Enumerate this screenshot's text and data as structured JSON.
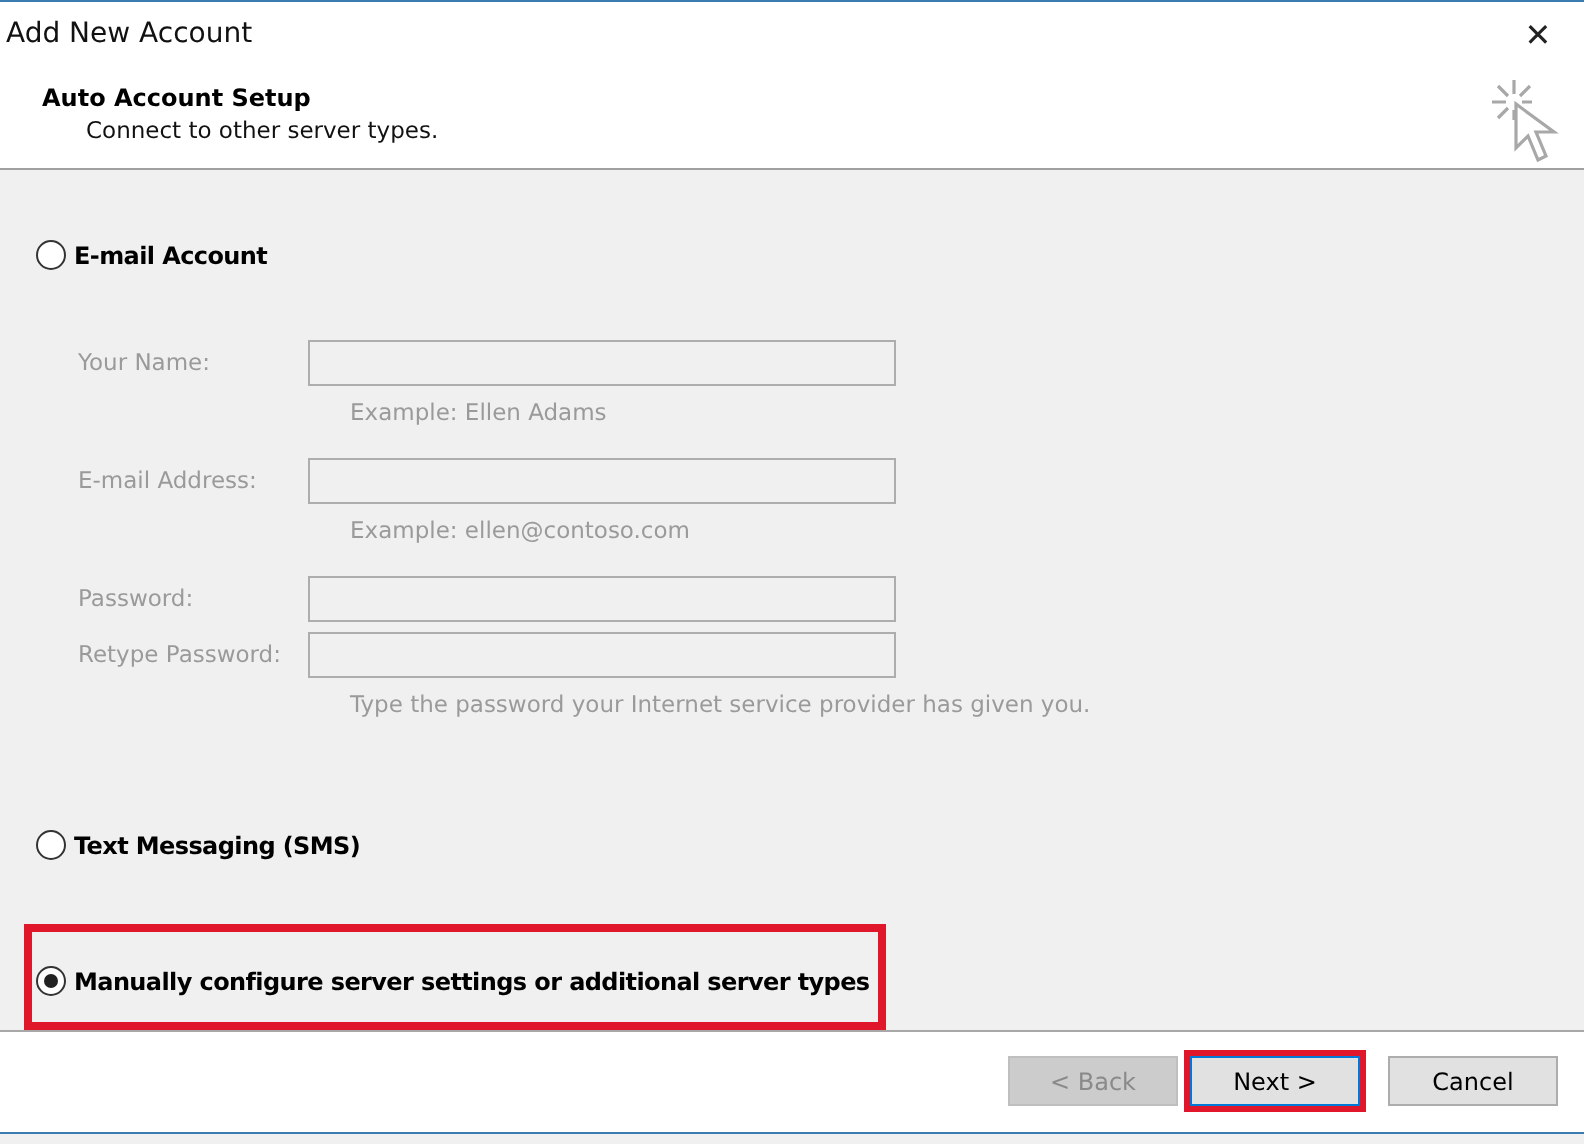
{
  "window": {
    "title": "Add New Account",
    "close": "✕"
  },
  "header": {
    "title": "Auto Account Setup",
    "subtitle": "Connect to other server types."
  },
  "options": [
    {
      "label": "E-mail Account",
      "selected": false,
      "highlighted": false,
      "disabled": true,
      "fields": [
        {
          "label": "Your Name:",
          "hint": "Example: Ellen Adams"
        },
        {
          "label": "E-mail Address:",
          "hint": "Example: ellen@contoso.com"
        },
        {
          "label": "Password:"
        },
        {
          "label": "Retype Password:",
          "hint": "Type the password your Internet service provider has given you."
        }
      ]
    },
    {
      "label": "Text Messaging (SMS)",
      "selected": false,
      "highlighted": false
    },
    {
      "label": "Manually configure server settings or additional server types",
      "selected": true,
      "highlighted": true
    }
  ],
  "buttons": [
    {
      "label": "< Back",
      "disabled": true,
      "highlighted": false
    },
    {
      "label": "Next >",
      "disabled": false,
      "highlighted": true
    },
    {
      "label": "Cancel",
      "disabled": false,
      "highlighted": false
    }
  ]
}
